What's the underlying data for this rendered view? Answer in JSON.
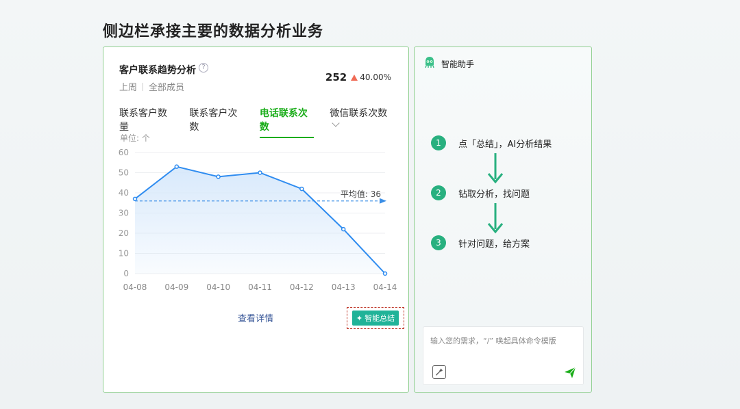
{
  "page": {
    "title": "侧边栏承接主要的数据分析业务"
  },
  "card": {
    "title": "客户联系趋势分析",
    "period": "上周",
    "scope": "全部成员",
    "metric_value": "252",
    "metric_change": "40.00%",
    "tabs": [
      {
        "label": "联系客户数量",
        "active": false
      },
      {
        "label": "联系客户次数",
        "active": false
      },
      {
        "label": "电话联系次数",
        "active": true
      },
      {
        "label": "微信联系次数",
        "active": false
      }
    ],
    "detail_link": "查看详情",
    "ai_button": "智能总结"
  },
  "chart_data": {
    "type": "area",
    "unit_label": "单位: 个",
    "categories": [
      "04-08",
      "04-09",
      "04-10",
      "04-11",
      "04-12",
      "04-13",
      "04-14"
    ],
    "values": [
      37,
      53,
      48,
      50,
      42,
      22,
      0
    ],
    "ylim": [
      0,
      60
    ],
    "yticks": [
      0,
      10,
      20,
      30,
      40,
      50,
      60
    ],
    "average": 36,
    "average_label": "平均值: 36",
    "grid": true,
    "colors": {
      "line": "#2f8cf0",
      "fill": "#d6e8fb",
      "avg": "#3a8ee6"
    }
  },
  "panel": {
    "title": "智能助手",
    "steps": [
      {
        "num": "1",
        "text": "点「总结」，AI分析结果"
      },
      {
        "num": "2",
        "text": "钻取分析，找问题"
      },
      {
        "num": "3",
        "text": "针对问题，给方案"
      }
    ],
    "input_placeholder": "输入您的需求，“/” 唤起具体命令模版",
    "accent": "#28b07f"
  }
}
